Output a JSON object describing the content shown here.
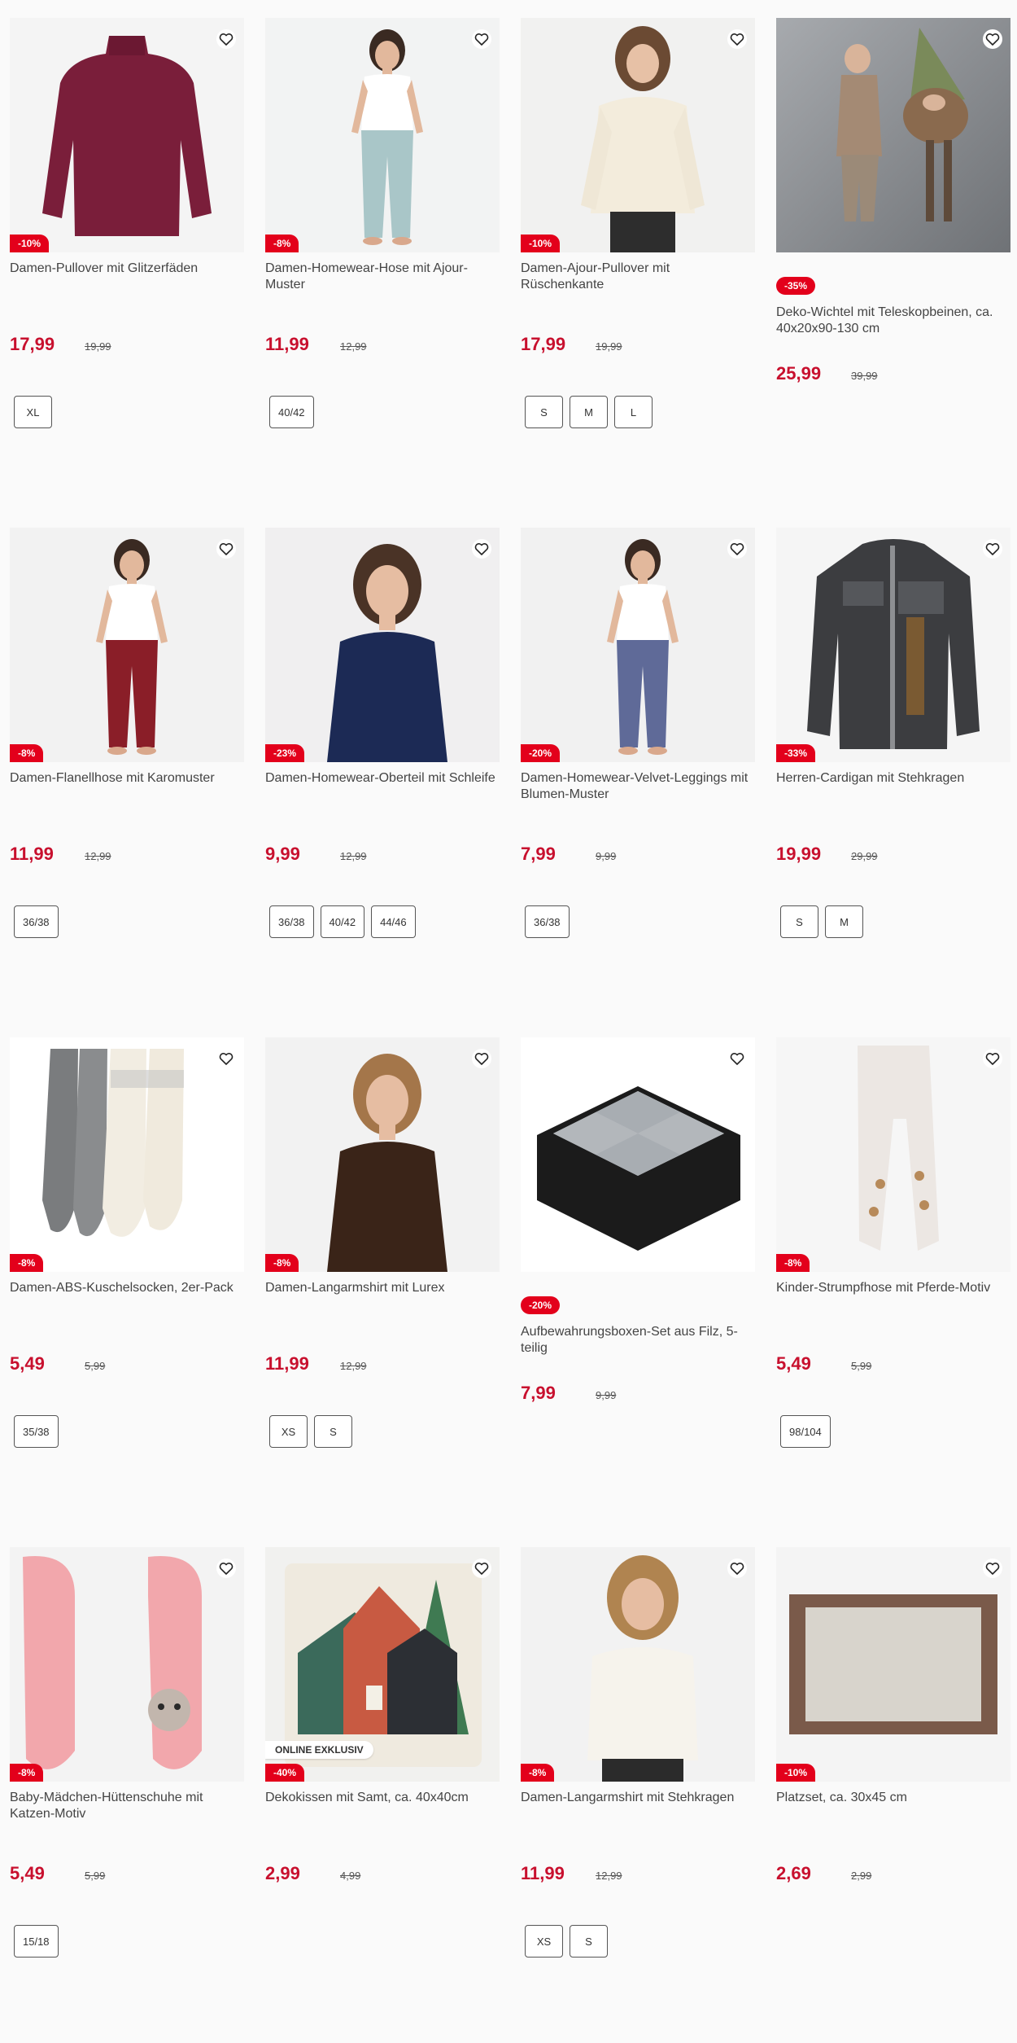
{
  "products": [
    {
      "title": "Damen-Pullover mit Glitzerfäden",
      "price": "17,99",
      "old_price": "19,99",
      "discount": "-10%",
      "sizes": [
        "XL"
      ],
      "image": "maroon-knit-sweater",
      "wishlist_icon": "heart-outline-icon"
    },
    {
      "title": "Damen-Homewear-Hose mit Ajour-Muster",
      "price": "11,99",
      "old_price": "12,99",
      "discount": "-8%",
      "sizes": [
        "40/42"
      ],
      "image": "woman-light-blue-pants",
      "wishlist_icon": "heart-outline-icon"
    },
    {
      "title": "Damen-Ajour-Pullover mit Rüschenkante",
      "price": "17,99",
      "old_price": "19,99",
      "discount": "-10%",
      "sizes": [
        "S",
        "M",
        "L"
      ],
      "image": "woman-cream-sweater",
      "wishlist_icon": "heart-outline-icon"
    },
    {
      "title": "Deko-Wichtel mit Teleskopbeinen, ca. 40x20x90-130 cm",
      "price": "25,99",
      "old_price": "39,99",
      "discount": "-35%",
      "sizes": [],
      "image": "child-with-gnome",
      "wishlist_icon": "heart-outline-icon"
    },
    {
      "title": "Damen-Flanellhose mit Karomuster",
      "price": "11,99",
      "old_price": "12,99",
      "discount": "-8%",
      "sizes": [
        "36/38"
      ],
      "image": "woman-plaid-pants",
      "wishlist_icon": "heart-outline-icon"
    },
    {
      "title": "Damen-Homewear-Oberteil mit Schleife",
      "price": "9,99",
      "old_price": "12,99",
      "discount": "-23%",
      "sizes": [
        "36/38",
        "40/42",
        "44/46"
      ],
      "image": "woman-navy-top",
      "wishlist_icon": "heart-outline-icon"
    },
    {
      "title": "Damen-Homewear-Velvet-Leggings mit Blumen-Muster",
      "price": "7,99",
      "old_price": "9,99",
      "discount": "-20%",
      "sizes": [
        "36/38"
      ],
      "image": "woman-floral-leggings",
      "wishlist_icon": "heart-outline-icon"
    },
    {
      "title": "Herren-Cardigan mit Stehkragen",
      "price": "19,99",
      "old_price": "29,99",
      "discount": "-33%",
      "sizes": [
        "S",
        "M"
      ],
      "image": "grey-men-cardigan",
      "wishlist_icon": "heart-outline-icon"
    },
    {
      "title": "Damen-ABS-Kuschelsocken, 2er-Pack",
      "price": "5,49",
      "old_price": "5,99",
      "discount": "-8%",
      "sizes": [
        "35/38"
      ],
      "image": "grey-white-socks",
      "wishlist_icon": "heart-outline-icon"
    },
    {
      "title": "Damen-Langarmshirt mit Lurex",
      "price": "11,99",
      "old_price": "12,99",
      "discount": "-8%",
      "sizes": [
        "XS",
        "S"
      ],
      "image": "woman-brown-sheer-top",
      "wishlist_icon": "heart-outline-icon"
    },
    {
      "title": "Aufbewahrungsboxen-Set aus Filz, 5-teilig",
      "price": "7,99",
      "old_price": "9,99",
      "discount": "-20%",
      "sizes": [],
      "image": "felt-storage-boxes",
      "wishlist_icon": "heart-outline-icon"
    },
    {
      "title": "Kinder-Strumpfhose mit Pferde-Motiv",
      "price": "5,49",
      "old_price": "5,99",
      "discount": "-8%",
      "sizes": [
        "98/104"
      ],
      "image": "kids-tights-horses",
      "wishlist_icon": "heart-outline-icon"
    },
    {
      "title": "Baby-Mädchen-Hüttenschuhe mit Katzen-Motiv",
      "price": "5,49",
      "old_price": "5,99",
      "discount": "-8%",
      "sizes": [
        "15/18"
      ],
      "image": "pink-baby-slippers",
      "wishlist_icon": "heart-outline-icon"
    },
    {
      "title": "Dekokissen mit Samt, ca. 40x40cm",
      "price": "2,99",
      "old_price": "4,99",
      "discount": "-40%",
      "sizes": [],
      "online_label": "ONLINE EXKLUSIV",
      "image": "house-motif-cushion",
      "wishlist_icon": "heart-outline-icon"
    },
    {
      "title": "Damen-Langarmshirt mit Stehkragen",
      "price": "11,99",
      "old_price": "12,99",
      "discount": "-8%",
      "sizes": [
        "XS",
        "S"
      ],
      "image": "woman-white-top",
      "wishlist_icon": "heart-outline-icon"
    },
    {
      "title": "Platzset, ca. 30x45 cm",
      "price": "2,69",
      "old_price": "2,99",
      "discount": "-10%",
      "sizes": [],
      "image": "brown-placemat",
      "wishlist_icon": "heart-outline-icon"
    }
  ],
  "colors": {
    "accent": "#e3001b",
    "price": "#c8102e",
    "background": "#fafafa"
  }
}
